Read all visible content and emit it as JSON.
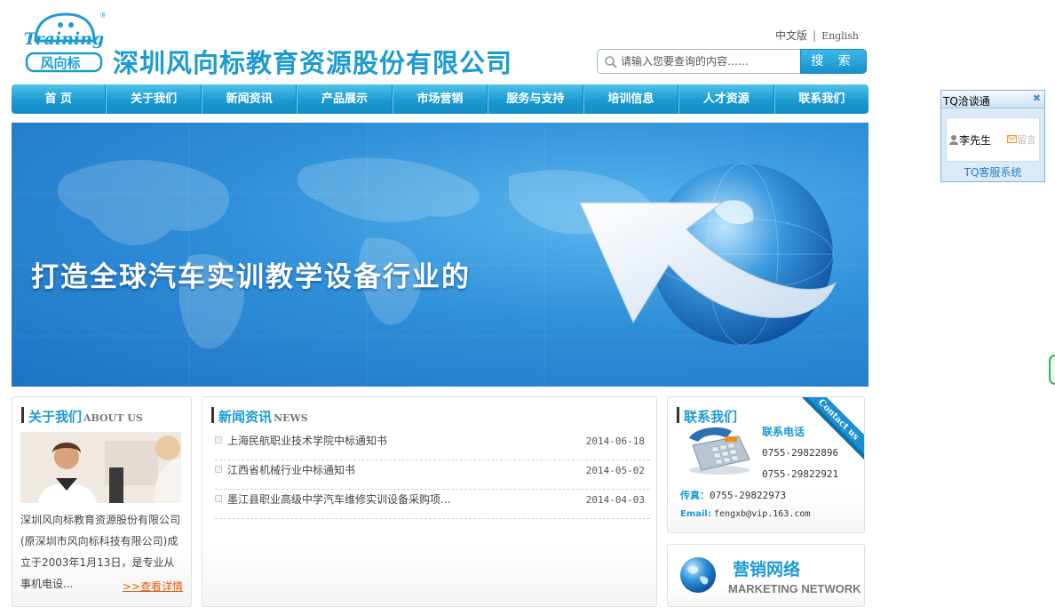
{
  "header": {
    "logo_text": "Training",
    "logo_cn": "风向标",
    "logo_reg": "®",
    "company_name": "深圳风向标教育资源股份有限公司",
    "lang_cn": "中文版",
    "lang_sep": "|",
    "lang_en": "English",
    "search_placeholder": "请输入您要查询的内容……",
    "search_button": "搜 索"
  },
  "nav": {
    "items": [
      "首 页",
      "关于我们",
      "新闻资讯",
      "产品展示",
      "市场营销",
      "服务与支持",
      "培训信息",
      "人才资源",
      "联系我们"
    ]
  },
  "banner": {
    "slogan": "打造全球汽车实训教学设备行业的"
  },
  "about": {
    "title_cn": "关于我们",
    "title_en": "ABOUT US",
    "text": "深圳风向标教育资源股份有限公司(原深圳市风向标科技有限公司)成立于2003年1月13日，是专业从事机电设...",
    "more": ">>查看详情"
  },
  "news": {
    "title_cn": "新闻资讯",
    "title_en": "NEWS",
    "items": [
      {
        "title": "上海民航职业技术学院中标通知书",
        "date": "2014-06-18"
      },
      {
        "title": "江西省机械行业中标通知书",
        "date": "2014-05-02"
      },
      {
        "title": "墨江县职业高级中学汽车维修实训设备采购项...",
        "date": "2014-04-03"
      }
    ]
  },
  "contact": {
    "title_cn": "联系我们",
    "ribbon": "Contact us",
    "phone_label": "联系电话",
    "phone1": "0755-29822896",
    "phone2": "0755-29822921",
    "fax_label": "传真：",
    "fax": "0755-29822973",
    "email_label": "Email:",
    "email": "fengxb@vip.163.com"
  },
  "marketing": {
    "title_cn": "营销网络",
    "title_en": "MARKETING NETWORK"
  },
  "tq": {
    "title": "TQ洽谈通",
    "close": "✖",
    "agent": "李先生",
    "message": "留言",
    "footer": "TQ客服系统"
  },
  "colors": {
    "brand_blue": "#1c9bd2",
    "nav_blue": "#1b9ad1",
    "more_link": "#e45b0e"
  }
}
